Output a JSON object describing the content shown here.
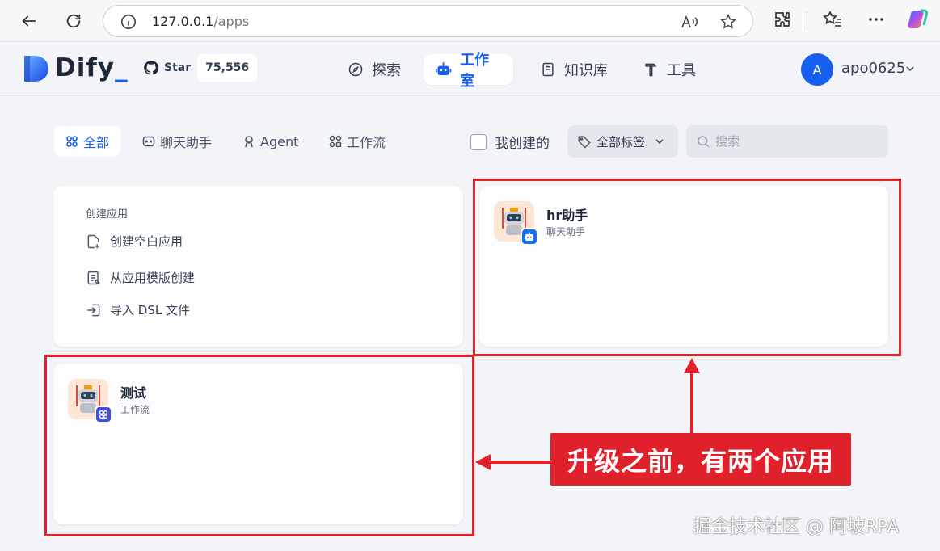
{
  "browser": {
    "url_host": "127.0.0.1",
    "url_path": "/apps"
  },
  "header": {
    "logo_text": "Dify",
    "github_star_label": "Star",
    "github_star_count": "75,556",
    "nav": [
      {
        "label": "探索",
        "icon": "compass-icon"
      },
      {
        "label": "工作室",
        "icon": "robot-icon",
        "active": true
      },
      {
        "label": "知识库",
        "icon": "book-icon"
      },
      {
        "label": "工具",
        "icon": "hammer-icon"
      }
    ],
    "user": {
      "initial": "A",
      "name": "apo0625"
    }
  },
  "filters": {
    "tabs": [
      {
        "label": "全部",
        "icon": "grid-icon",
        "active": true
      },
      {
        "label": "聊天助手",
        "icon": "chat-icon"
      },
      {
        "label": "Agent",
        "icon": "agent-icon"
      },
      {
        "label": "工作流",
        "icon": "workflow-icon"
      }
    ],
    "mine_label": "我创建的",
    "tag_label": "全部标签",
    "search_placeholder": "搜索"
  },
  "create_card": {
    "title": "创建应用",
    "items": [
      {
        "label": "创建空白应用",
        "icon": "file-plus-icon"
      },
      {
        "label": "从应用模版创建",
        "icon": "template-icon"
      },
      {
        "label": "导入 DSL 文件",
        "icon": "import-icon"
      }
    ]
  },
  "apps": [
    {
      "name": "hr助手",
      "type": "聊天助手",
      "badge_color": "#1570ef"
    },
    {
      "name": "测试",
      "type": "工作流",
      "badge_color": "#444ce7"
    }
  ],
  "annotation": {
    "callout_text": "升级之前，有两个应用",
    "color": "#e0202a"
  },
  "watermark": "掘金技术社区 @ 阿坡RPA"
}
